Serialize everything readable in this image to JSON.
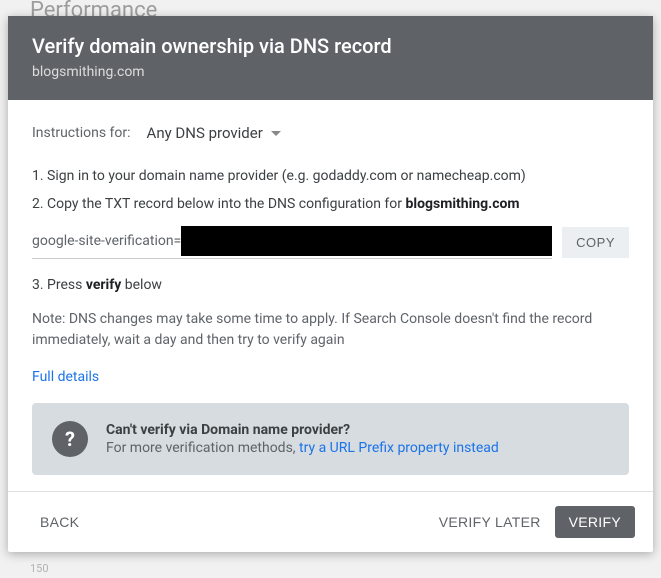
{
  "background": {
    "header": "Performance",
    "axis_num": "150"
  },
  "header": {
    "title": "Verify domain ownership via DNS record",
    "domain": "blogsmithing.com"
  },
  "instructions": {
    "label": "Instructions for:",
    "provider": "Any DNS provider"
  },
  "steps": {
    "s1": "1. Sign in to your domain name provider (e.g. godaddy.com or namecheap.com)",
    "s2_pre": "2. Copy the TXT record below into the DNS configuration for ",
    "s2_bold": "blogsmithing.com",
    "s3_pre": "3. Press ",
    "s3_bold": "verify",
    "s3_post": " below"
  },
  "txt": {
    "prefix": "google-site-verification=",
    "copy": "COPY"
  },
  "note": "Note: DNS changes may take some time to apply. If Search Console doesn't find the record immediately, wait a day and then try to verify again",
  "links": {
    "full_details": "Full details"
  },
  "help": {
    "icon": "?",
    "title": "Can't verify via Domain name provider?",
    "text_pre": "For more verification methods, ",
    "link": "try a URL Prefix property instead"
  },
  "footer": {
    "back": "BACK",
    "later": "VERIFY LATER",
    "verify": "VERIFY"
  }
}
